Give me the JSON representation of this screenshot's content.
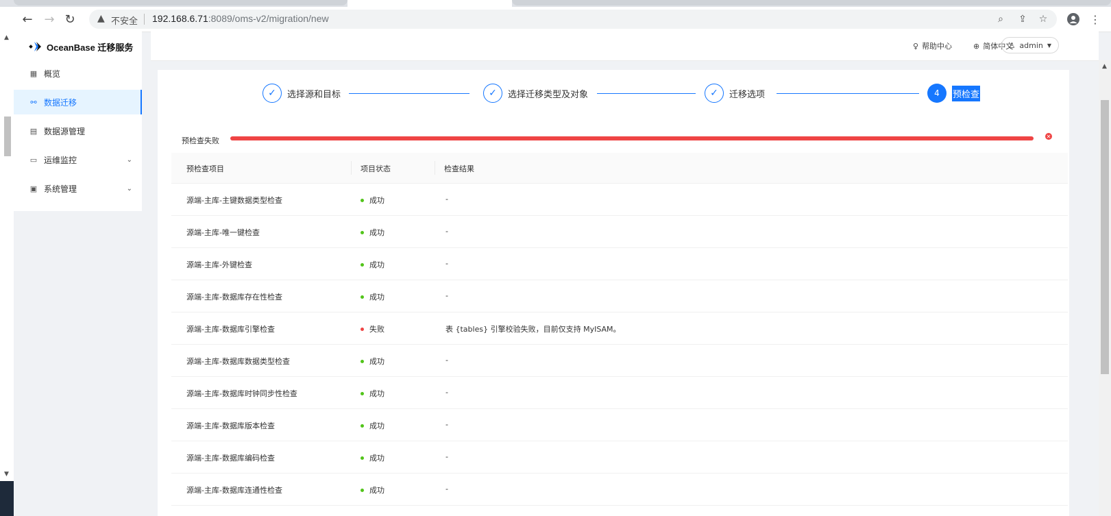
{
  "browser": {
    "insecure_label": "不安全",
    "url_host": "192.168.6.71",
    "url_rest": ":8089/oms-v2/migration/new"
  },
  "app": {
    "logo_text": "OceanBase 迁移服务",
    "brand_color": "#1677ff"
  },
  "sidebar": {
    "items": [
      {
        "label": "概览",
        "icon": "grid-icon"
      },
      {
        "label": "数据迁移",
        "icon": "sitemap-icon",
        "active": true
      },
      {
        "label": "数据源管理",
        "icon": "database-doc-icon"
      },
      {
        "label": "运维监控",
        "icon": "monitor-icon",
        "expandable": true
      },
      {
        "label": "系统管理",
        "icon": "settings-box-icon",
        "expandable": true
      }
    ]
  },
  "header": {
    "help_label": "帮助中心",
    "lang_label": "简体中文",
    "user_label": "admin"
  },
  "steps": [
    {
      "label": "选择源和目标",
      "status": "done"
    },
    {
      "label": "选择迁移类型及对象",
      "status": "done"
    },
    {
      "label": "迁移选项",
      "status": "done"
    },
    {
      "label": "预检查",
      "number": "4",
      "status": "current"
    }
  ],
  "precheck": {
    "label": "预检查失败",
    "progress": 1.0,
    "status_color": "#ef4444"
  },
  "table": {
    "headers": [
      "预检查项目",
      "项目状态",
      "检查结果"
    ],
    "rows": [
      {
        "item": "源端-主库-主键数据类型检查",
        "status": "成功",
        "ok": true,
        "result": "-"
      },
      {
        "item": "源端-主库-唯一键检查",
        "status": "成功",
        "ok": true,
        "result": "-"
      },
      {
        "item": "源端-主库-外键检查",
        "status": "成功",
        "ok": true,
        "result": "-"
      },
      {
        "item": "源端-主库-数据库存在性检查",
        "status": "成功",
        "ok": true,
        "result": "-"
      },
      {
        "item": "源端-主库-数据库引擎检查",
        "status": "失败",
        "ok": false,
        "result": "表 {tables} 引擎校验失败，目前仅支持 MyISAM。"
      },
      {
        "item": "源端-主库-数据库数据类型检查",
        "status": "成功",
        "ok": true,
        "result": "-"
      },
      {
        "item": "源端-主库-数据库时钟同步性检查",
        "status": "成功",
        "ok": true,
        "result": "-"
      },
      {
        "item": "源端-主库-数据库版本检查",
        "status": "成功",
        "ok": true,
        "result": "-"
      },
      {
        "item": "源端-主库-数据库编码检查",
        "status": "成功",
        "ok": true,
        "result": "-"
      },
      {
        "item": "源端-主库-数据库连通性检查",
        "status": "成功",
        "ok": true,
        "result": "-"
      }
    ],
    "success_color": "#52c41a",
    "fail_color": "#ef4444"
  }
}
